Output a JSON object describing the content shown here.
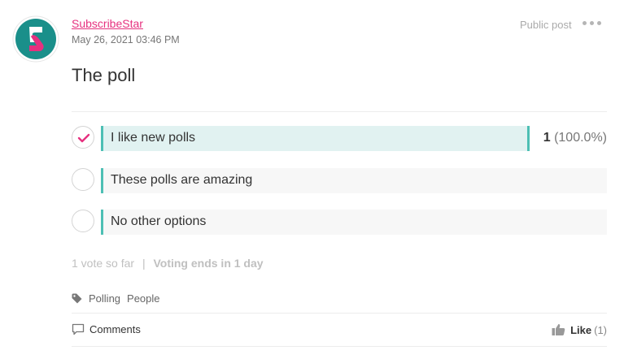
{
  "post": {
    "author": "SubscribeStar",
    "date": "May 26, 2021 03:46 PM",
    "visibility": "Public post",
    "title": "The poll"
  },
  "poll": {
    "options": [
      {
        "label": "I like new polls",
        "selected": true,
        "count": "1",
        "percent": "(100.0%)",
        "share": 1.0
      },
      {
        "label": "These polls are amazing",
        "selected": false,
        "share": 0
      },
      {
        "label": "No other options",
        "selected": false,
        "share": 0
      }
    ],
    "votes_text": "1 vote so far",
    "separator": "|",
    "ends_text": "Voting ends in 1 day"
  },
  "tags": [
    "Polling",
    "People"
  ],
  "footer": {
    "comments_label": "Comments",
    "like_label": "Like",
    "like_count": "(1)"
  },
  "colors": {
    "brand": "#e6317f",
    "teal": "#4dbfb4",
    "avatar_bg": "#1a8f8a"
  },
  "icons": {
    "avatar": "subscribestar-logo",
    "more": "more-dots-icon",
    "check": "check-icon",
    "tag": "tag-icon",
    "comments": "comment-icon",
    "like": "thumbs-up-icon"
  }
}
